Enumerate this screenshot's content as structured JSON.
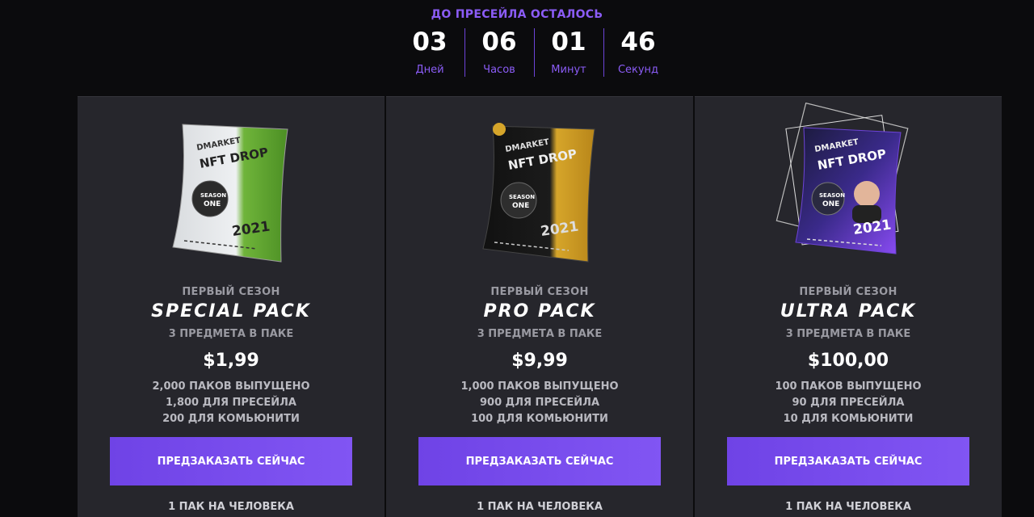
{
  "countdown": {
    "title": "ДО ПРЕСЕЙЛА ОСТАЛОСЬ",
    "units": [
      {
        "value": "03",
        "label": "Дней"
      },
      {
        "value": "06",
        "label": "Часов"
      },
      {
        "value": "01",
        "label": "Минут"
      },
      {
        "value": "46",
        "label": "Секунд"
      }
    ]
  },
  "pack_text": {
    "brand_line1": "DMARKET",
    "brand_line2": "NFT DROP",
    "season_badge_1": "SEASON",
    "season_badge_2": "ONE",
    "year": "2021"
  },
  "cards": [
    {
      "season": "ПЕРВЫЙ СЕЗОН",
      "name": "SPECIAL PACK",
      "items": "3 ПРЕДМЕТА В ПАКЕ",
      "price": "$1,99",
      "issued": "2,000 ПАКОВ ВЫПУЩЕНО",
      "presale": "1,800 ДЛЯ ПРЕСЕЙЛА",
      "community": "200 ДЛЯ КОМЬЮНИТИ",
      "button": "ПРЕДЗАКАЗАТЬ СЕЙЧАС",
      "limit": "1 ПАК НА ЧЕЛОВЕКА",
      "accent": "#6fb43a"
    },
    {
      "season": "ПЕРВЫЙ СЕЗОН",
      "name": "PRO PACK",
      "items": "3 ПРЕДМЕТА В ПАКЕ",
      "price": "$9,99",
      "issued": "1,000 ПАКОВ ВЫПУЩЕНО",
      "presale": "900 ДЛЯ ПРЕСЕЙЛА",
      "community": "100 ДЛЯ КОМЬЮНИТИ",
      "button": "ПРЕДЗАКАЗАТЬ СЕЙЧАС",
      "limit": "1 ПАК НА ЧЕЛОВЕКА",
      "accent": "#d6a52a"
    },
    {
      "season": "ПЕРВЫЙ СЕЗОН",
      "name": "ULTRA PACK",
      "items": "3 ПРЕДМЕТА В ПАКЕ",
      "price": "$100,00",
      "issued": "100 ПАКОВ ВЫПУЩЕНО",
      "presale": "90 ДЛЯ ПРЕСЕЙЛА",
      "community": "10 ДЛЯ КОМЬЮНИТИ",
      "button": "ПРЕДЗАКАЗАТЬ СЕЙЧАС",
      "limit": "1 ПАК НА ЧЕЛОВЕКА",
      "accent": "#7c3aed"
    }
  ],
  "colors": {
    "background": "#0b0b0d",
    "card": "#26262c",
    "accent_purple": "#8b5cf6",
    "button": "#7a4df0"
  }
}
